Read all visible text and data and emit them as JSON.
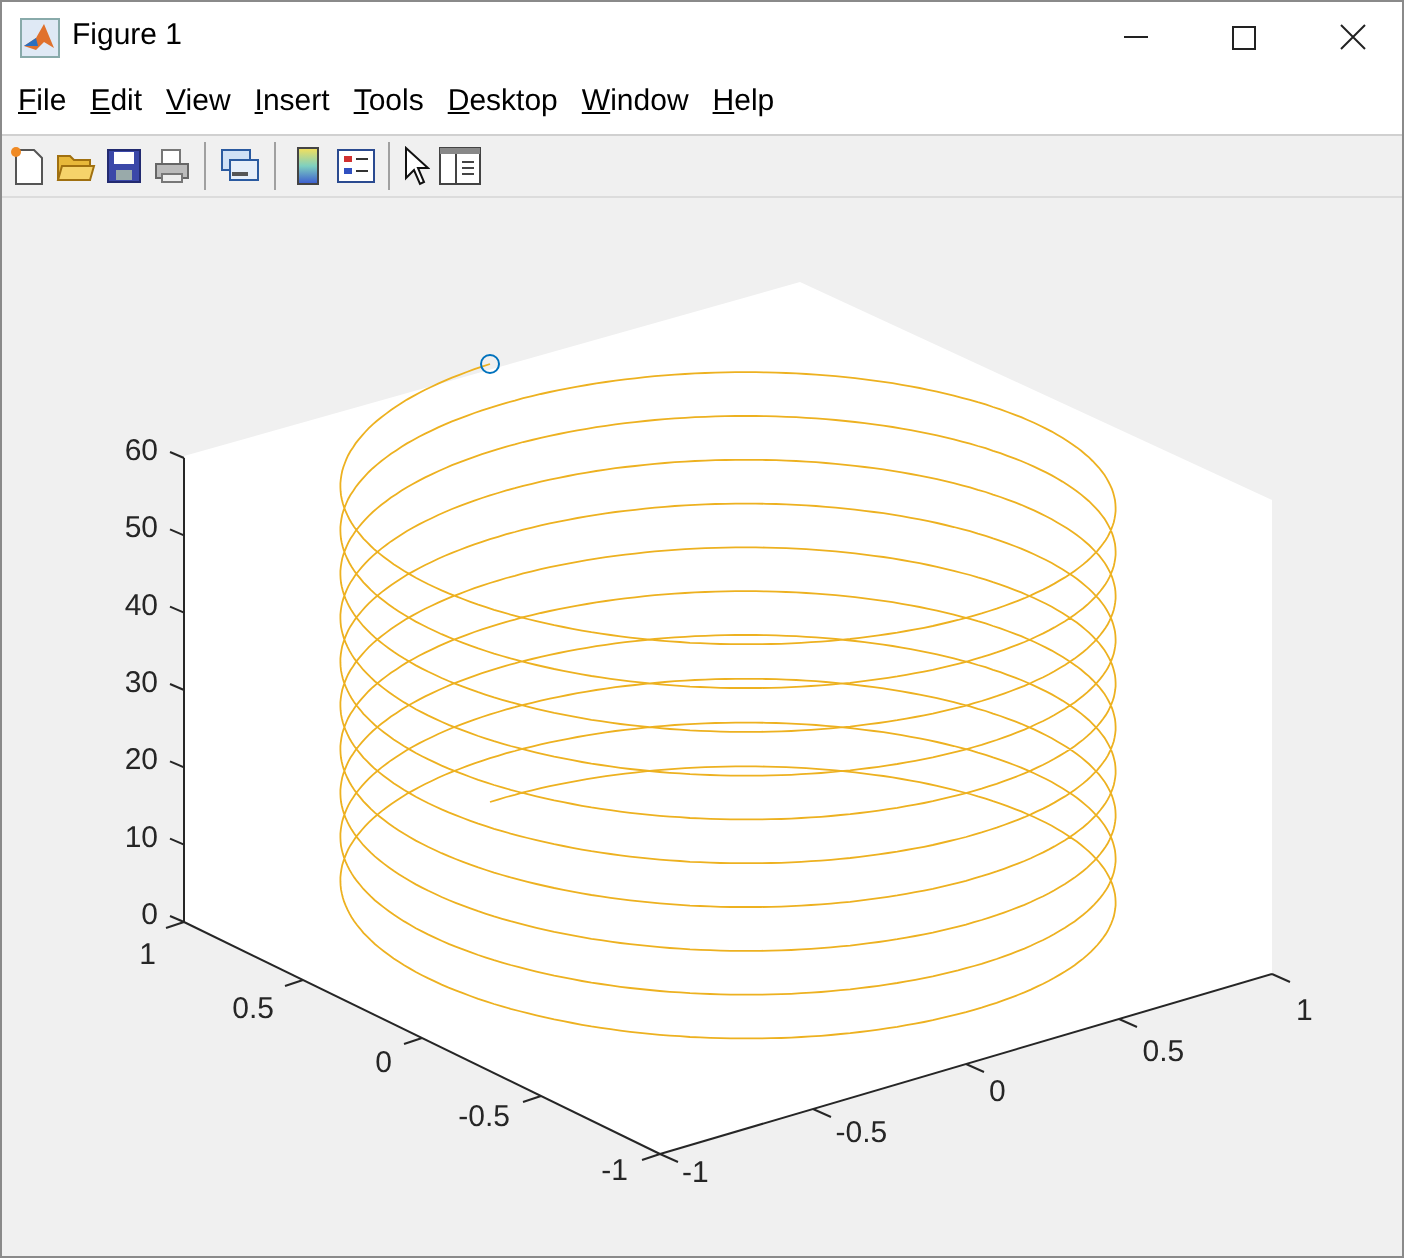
{
  "window": {
    "title": "Figure 1"
  },
  "menu": [
    "File",
    "Edit",
    "View",
    "Insert",
    "Tools",
    "Desktop",
    "Window",
    "Help"
  ],
  "axes": {
    "z_ticks": [
      "60",
      "50",
      "40",
      "30",
      "20",
      "10",
      "0"
    ],
    "x_ticks": [
      "1",
      "0.5",
      "0",
      "-0.5",
      "-1"
    ],
    "y_ticks": [
      "-1",
      "-0.5",
      "0",
      "0.5",
      "1"
    ]
  }
}
